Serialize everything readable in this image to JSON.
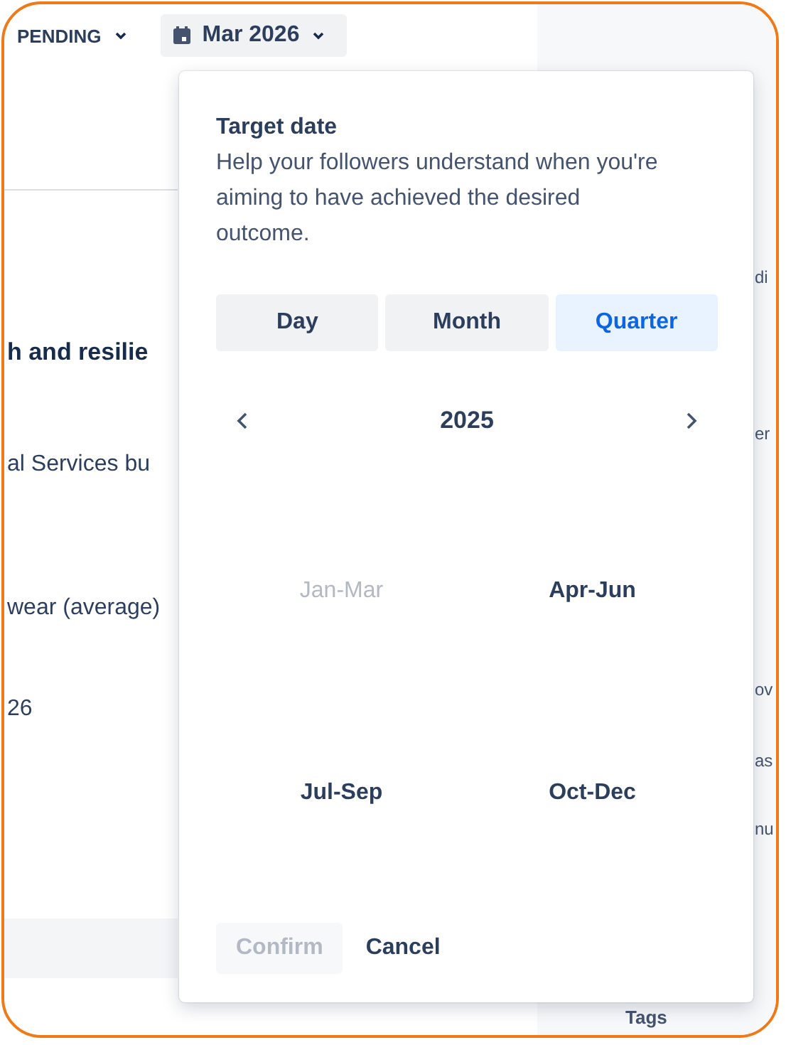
{
  "status_filter": {
    "label": "PENDING"
  },
  "date_button": {
    "label": "Mar 2026"
  },
  "background_texts": [
    {
      "text": "h and resilie",
      "bold": true
    },
    {
      "text": "al Services bu",
      "bold": false
    },
    {
      "text": "wear (average)",
      "bold": false
    },
    {
      "text": "26",
      "bold": false
    }
  ],
  "side_texts": [
    "di",
    "er",
    "ov",
    "as",
    "nu"
  ],
  "side_heading": "Tags",
  "popover": {
    "title": "Target date",
    "description": "Help your followers understand when you're aiming to have achieved the desired outcome.",
    "modes": [
      {
        "label": "Day",
        "selected": false
      },
      {
        "label": "Month",
        "selected": false
      },
      {
        "label": "Quarter",
        "selected": true
      }
    ],
    "year": "2025",
    "quarters": [
      {
        "label": "Jan-Mar",
        "disabled": true
      },
      {
        "label": "Apr-Jun",
        "disabled": false
      },
      {
        "label": "Jul-Sep",
        "disabled": false
      },
      {
        "label": "Oct-Dec",
        "disabled": false
      }
    ],
    "confirm": {
      "label": "Confirm",
      "disabled": true
    },
    "cancel": {
      "label": "Cancel"
    }
  }
}
